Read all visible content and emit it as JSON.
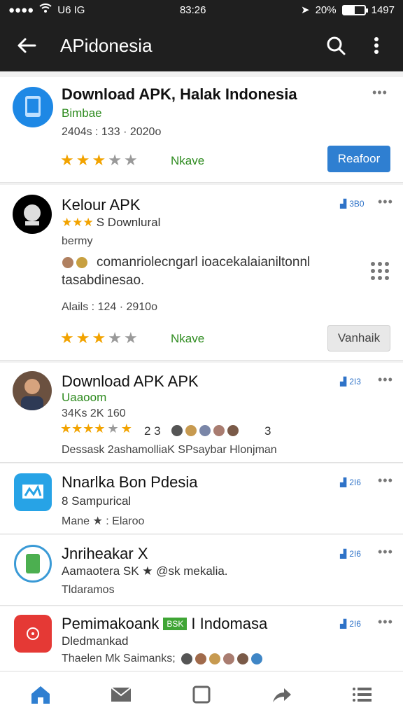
{
  "status_bar": {
    "left_text": "ᴵ ●●●●",
    "carrier": "U6 IG",
    "time": "83:26",
    "battery_pct": "20%",
    "right_text": "1497"
  },
  "app_bar": {
    "title": "APidonesia",
    "back_icon": "arrow-left-icon",
    "search_icon": "search-icon",
    "more_icon": "more-vertical-icon"
  },
  "items": [
    {
      "title": "Download APK, Halak Indonesia",
      "subtitle": "Bimbae",
      "meta": "2404s : 133 · 2020o",
      "rating_label": "Nkave",
      "rating": 3,
      "button_label": "Reafoor",
      "avatar_color": "#1e88e5"
    },
    {
      "title": "Kelour APK",
      "subtitle": "S Downlural",
      "extra_line": "bermy",
      "description_1": "comanriolecngarl ioacekalaianiltonnl",
      "description_2": "tasabdinesao.",
      "meta": "Alails : 124 · 2910o",
      "rating_label": "Nkave",
      "rating": 3,
      "button_label": "Vanhaik",
      "small_badge": "3B0"
    },
    {
      "title": "Download APK APK",
      "subtitle": "Uaaoom",
      "meta": "34Ks 2K 160",
      "chips_text": "2 3",
      "chips_text_2": "3",
      "description": "Dessask 2ashamolliaK SPsaybar Hlonjman",
      "small_badge": "2I3"
    },
    {
      "title": "Nnarlka Bon Pdesia",
      "subtitle": "8 Sampurical",
      "meta": "Mane ★ : Elaroo",
      "small_badge": "2I6"
    },
    {
      "title": "Jnriheakar X",
      "subtitle": "Aamaotera SK ★ @sk mekalia.",
      "meta": "Tldaramos",
      "small_badge": "2I6"
    },
    {
      "title": "Pemimakoank",
      "title_tail": "I Indomasa",
      "tag": "BSK",
      "subtitle": "Dledmankad",
      "meta": "Thaelen Mk Saimanks;",
      "small_badge": "2I6"
    }
  ],
  "bottom_nav": [
    {
      "icon": "home-icon"
    },
    {
      "icon": "mail-icon"
    },
    {
      "icon": "square-icon"
    },
    {
      "icon": "share-icon"
    },
    {
      "icon": "menu-list-icon"
    }
  ],
  "colors": {
    "accent": "#2f7fd1",
    "star": "#f2a300",
    "green_text": "#2e8b1f",
    "app_bar": "#1f1f1f"
  }
}
